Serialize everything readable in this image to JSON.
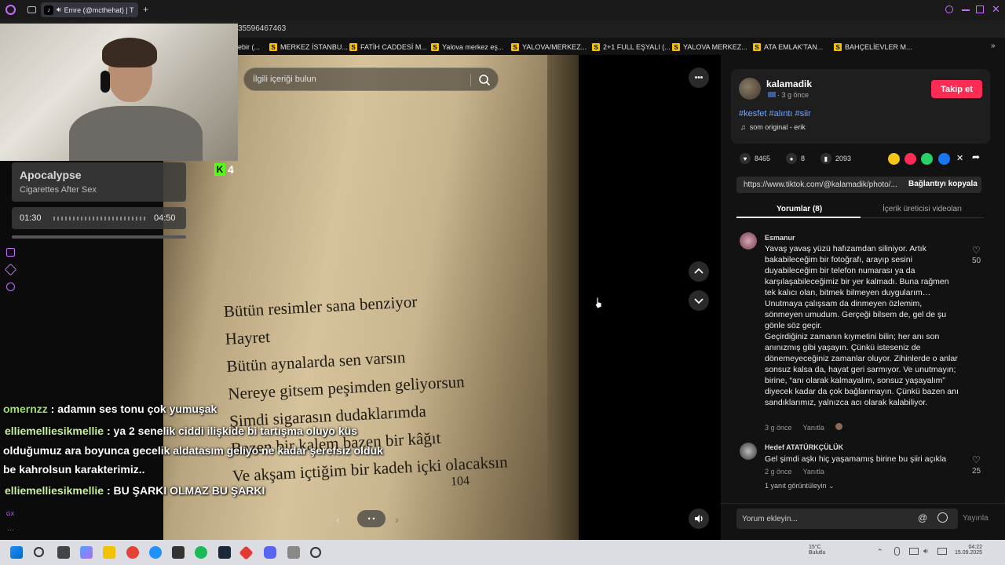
{
  "browser": {
    "tab_title": "Emre (@mcthehat) | T",
    "url_fragment": "35596467463",
    "bookmarks": [
      {
        "label": "ebir (..."
      },
      {
        "label": "MERKEZ İSTANBU..."
      },
      {
        "label": "FATİH CADDESİ M..."
      },
      {
        "label": "Yalova merkez eş..."
      },
      {
        "label": "YALOVA/MERKEZ..."
      },
      {
        "label": "2+1 FULL EŞYALI (..."
      },
      {
        "label": "YALOVA MERKEZ..."
      },
      {
        "label": "ATA EMLAK'TAN..."
      },
      {
        "label": "BAHÇELİEVLER M..."
      }
    ]
  },
  "overlay": {
    "song_title": "Apocalypse",
    "song_artist": "Cigarettes After Sex",
    "time_current": "01:30",
    "time_total": "04:50",
    "kick_count": "4",
    "chat": [
      {
        "user": "omernzz",
        "text": " : adamın ses tonu çok yumuşak"
      },
      {
        "user": "elliemelliesikmellie",
        "text": " : ya 2 senelik ciddi ilişkide bi tartışma oluyo küs"
      },
      {
        "user": "",
        "text": "olduğumuz ara boyunca gecelik aldatasım geliyo ne kadar şerefsiz olduk"
      },
      {
        "user": "",
        "text": "be kahrolsun karakterimiz.."
      },
      {
        "user": "elliemelliesikmellie",
        "text": " : BU ŞARKI OLMAZ BU ŞARKI"
      }
    ]
  },
  "media": {
    "search_placeholder": "İlgili içeriği bulun",
    "book_lines": [
      "Bütün resimler sana benziyor",
      "Hayret",
      "Bütün aynalarda sen varsın",
      "Nereye gitsem peşimden geliyorsun",
      "Şimdi sigarasın dudaklarımda",
      "Bazen bir kalem bazen bir kâğıt",
      "Ve akşam içtiğim bir kadeh içki olacaksın"
    ],
    "page_number": "104",
    "more_label": "•••",
    "slide_indicator": "• •"
  },
  "post": {
    "username": "kalamadik",
    "time_ago": "· 3 g önce",
    "follow_label": "Takip et",
    "tags": "#kesfet #alıntı #siir",
    "sound": "som original - erik",
    "likes": "8465",
    "comments": "8",
    "saves": "2093",
    "link": "https://www.tiktok.com/@kalamadik/photo/...",
    "copy_label": "Bağlantıyı kopyala",
    "tab_comments": "Yorumlar (8)",
    "tab_creator": "İçerik üreticisi videoları",
    "comment_placeholder": "Yorum ekleyin...",
    "publish_label": "Yayınla",
    "comment_list": [
      {
        "author": "Esmanur",
        "text": "Yavaş yavaş yüzü hafızamdan siliniyor. Artık bakabileceğim bir fotoğrafı, arayıp sesini duyabileceğim bir telefon numarası ya da karşılaşabileceğimiz bir yer kalmadı. Buna rağmen tek kalıcı olan, bitmek bilmeyen duygularım… Unutmaya çalışsam da dinmeyen özlemim, sönmeyen umudum. Gerçeği bilsem de, gel de şu gönle söz geçir.",
        "text2": "Geçirdiğiniz zamanın kıymetini bilin; her anı son anınızmış gibi yaşayın. Çünkü isteseniz de dönemeyeceğiniz zamanlar oluyor. Zihinlerde o anlar sonsuz kalsa da, hayat geri sarmıyor. Ve unutmayın; birine, “anı olarak kalmayalım, sonsuz yaşayalım” diyecek kadar da çok bağlanmayın. Çünkü bazen anı sandıklarımız, yalnızca acı olarak kalabiliyor.",
        "time": "3 g önce",
        "reply": "Yanıtla",
        "likes": "50"
      },
      {
        "author": "Hedef ATATÜRKÇÜLÜK",
        "text": "Gel şimdi aşkı hiç yaşamamış birine bu şiiri açıkla",
        "time": "2 g önce",
        "reply": "Yanıtla",
        "likes": "25"
      }
    ],
    "view_replies": "1 yanıt görüntüleyin"
  },
  "taskbar": {
    "weather_temp": "15°C",
    "weather_desc": "Bulutlu",
    "time": "04:22",
    "date": "15.09.2025"
  }
}
